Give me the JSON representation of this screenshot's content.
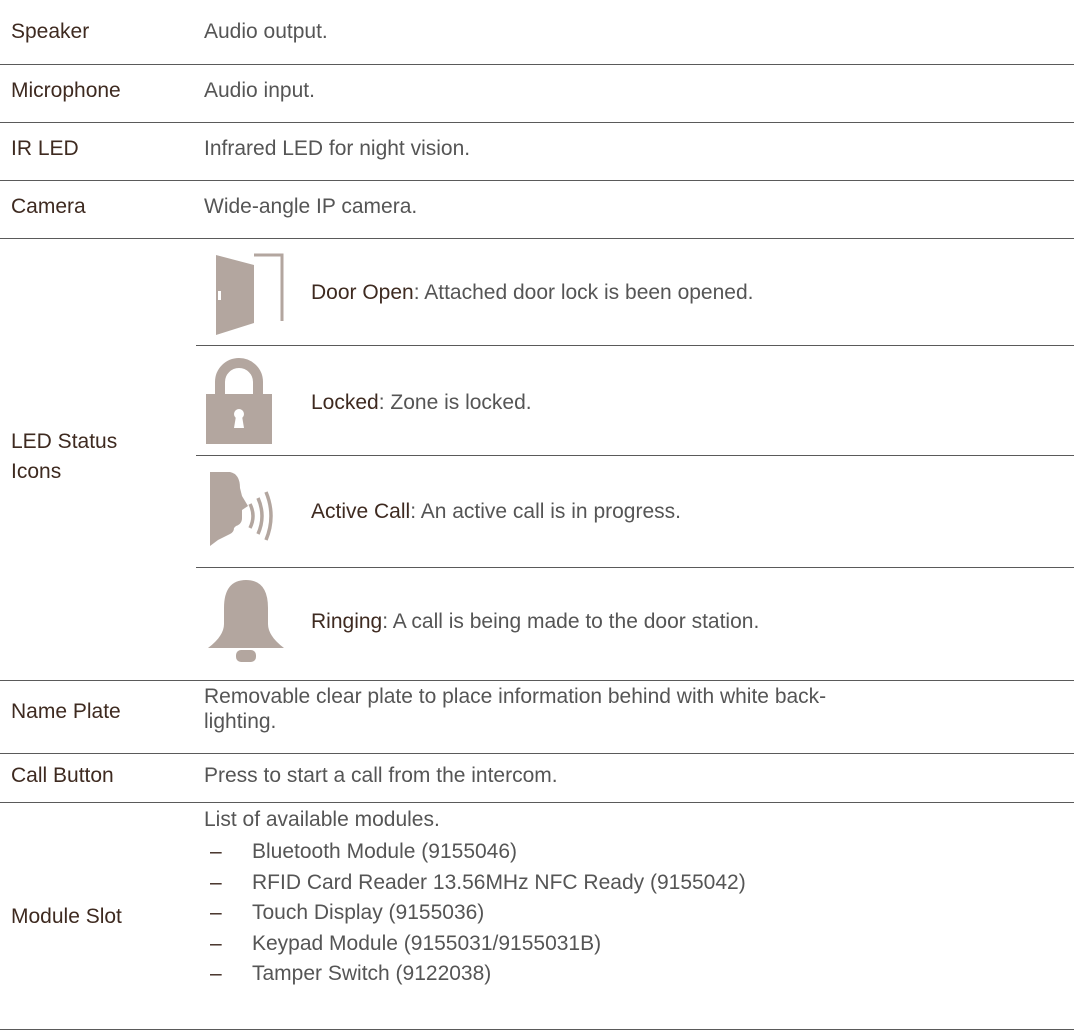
{
  "rows": {
    "speaker": {
      "label": "Speaker",
      "desc": "Audio output."
    },
    "microphone": {
      "label": "Microphone",
      "desc": "Audio input."
    },
    "ir_led": {
      "label": "IR LED",
      "desc": "Infrared LED for night vision."
    },
    "camera": {
      "label": "Camera",
      "desc": "Wide-angle IP camera."
    },
    "led_status": {
      "label_line1": "LED Status",
      "label_line2": "Icons",
      "items": [
        {
          "term": "Door Open",
          "text": ": Attached door lock is been opened.",
          "icon": "door-open-icon"
        },
        {
          "term": "Locked",
          "text": ": Zone is locked.",
          "icon": "padlock-icon"
        },
        {
          "term": "Active Call",
          "text": ": An active call is in progress.",
          "icon": "speaking-head-icon"
        },
        {
          "term": "Ringing",
          "text": ": A call is being made to the door station.",
          "icon": "bell-icon"
        }
      ]
    },
    "name_plate": {
      "label": "Name Plate",
      "desc_line1": "Removable clear plate to place information behind with white back-",
      "desc_line2": "lighting."
    },
    "call_button": {
      "label": "Call Button",
      "desc": "Press to start a call from the intercom."
    },
    "module_slot": {
      "label": "Module Slot",
      "intro": "List of available modules.",
      "dash": "–",
      "modules": [
        "Bluetooth Module (9155046)",
        "RFID Card Reader 13.56MHz NFC Ready (9155042)",
        "Touch Display (9155036)",
        "Keypad Module (9155031/9155031B)",
        "Tamper Switch (9122038)"
      ]
    }
  },
  "colors": {
    "icon": "#b3a69f",
    "label": "#3e2a20",
    "text": "#555555",
    "rule": "#5a5a5a"
  }
}
